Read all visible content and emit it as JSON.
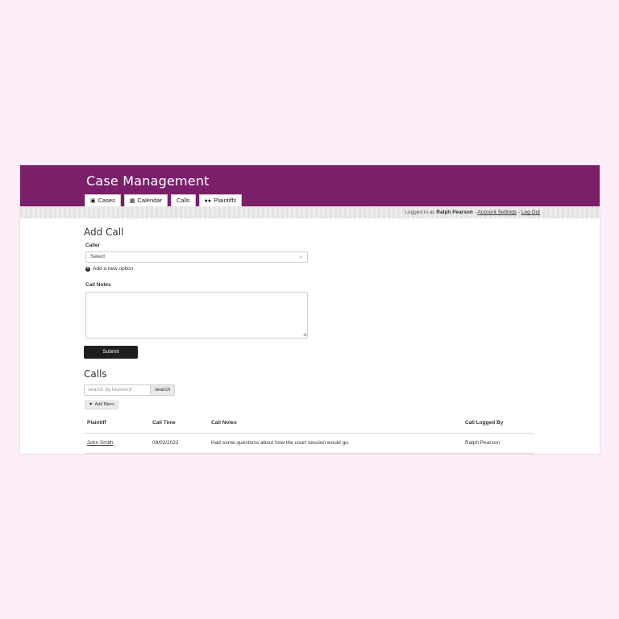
{
  "app": {
    "title": "Case Management"
  },
  "tabs": [
    {
      "label": "Cases",
      "icon": "briefcase-icon"
    },
    {
      "label": "Calendar",
      "icon": "calendar-icon"
    },
    {
      "label": "Calls",
      "icon": ""
    },
    {
      "label": "Plaintiffs",
      "icon": "users-icon"
    }
  ],
  "userbar": {
    "prefix": "Logged in as",
    "user": "Ralph Pearson",
    "sep1": "-",
    "settings": "Account Settings",
    "sep2": "-",
    "logout": "Log Out"
  },
  "add_call": {
    "heading": "Add Call",
    "caller_label": "Caller",
    "caller_value": "Select",
    "add_option": "Add a new option",
    "notes_label": "Call Notes",
    "notes_value": "",
    "submit_label": "Submit"
  },
  "calls": {
    "heading": "Calls",
    "search_placeholder": "search by keyword",
    "search_button": "search",
    "filters_button": "Add filters",
    "columns": [
      "Plaintiff",
      "Call Time",
      "Call Notes",
      "Call Logged By"
    ],
    "rows": [
      [
        "John Smith",
        "08/02/2022",
        "Had some questions about how the court session would go.",
        "Ralph Pearson"
      ]
    ]
  },
  "colors": {
    "header": "#7b1f6a",
    "page_background": "#fbeef8",
    "button_dark": "#1f1f1f"
  }
}
